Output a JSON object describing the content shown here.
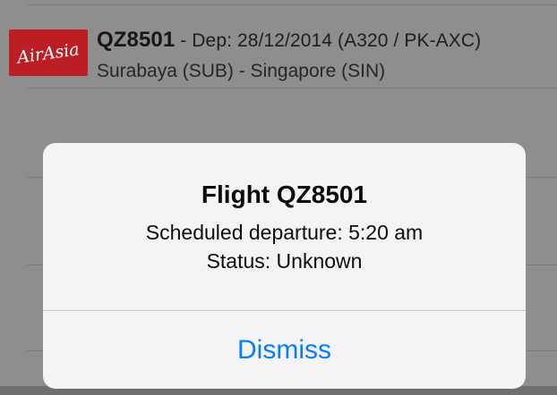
{
  "flight_row": {
    "logo_text": "AirAsia",
    "flight_number": "QZ8501",
    "departure": " - Dep: 28/12/2014 ",
    "aircraft": "(A320 / PK-AXC)",
    "route": "Surabaya (SUB) - Singapore (SIN)"
  },
  "alert": {
    "title": "Flight QZ8501",
    "scheduled_departure": "Scheduled departure: 5:20 am",
    "status": "Status: Unknown",
    "dismiss_label": "Dismiss"
  },
  "colors": {
    "brand_red": "#bb1e24",
    "ios_blue": "#0a7df5",
    "dimmed_background": "#8e8e8e",
    "alert_background": "#f4f4f4"
  }
}
